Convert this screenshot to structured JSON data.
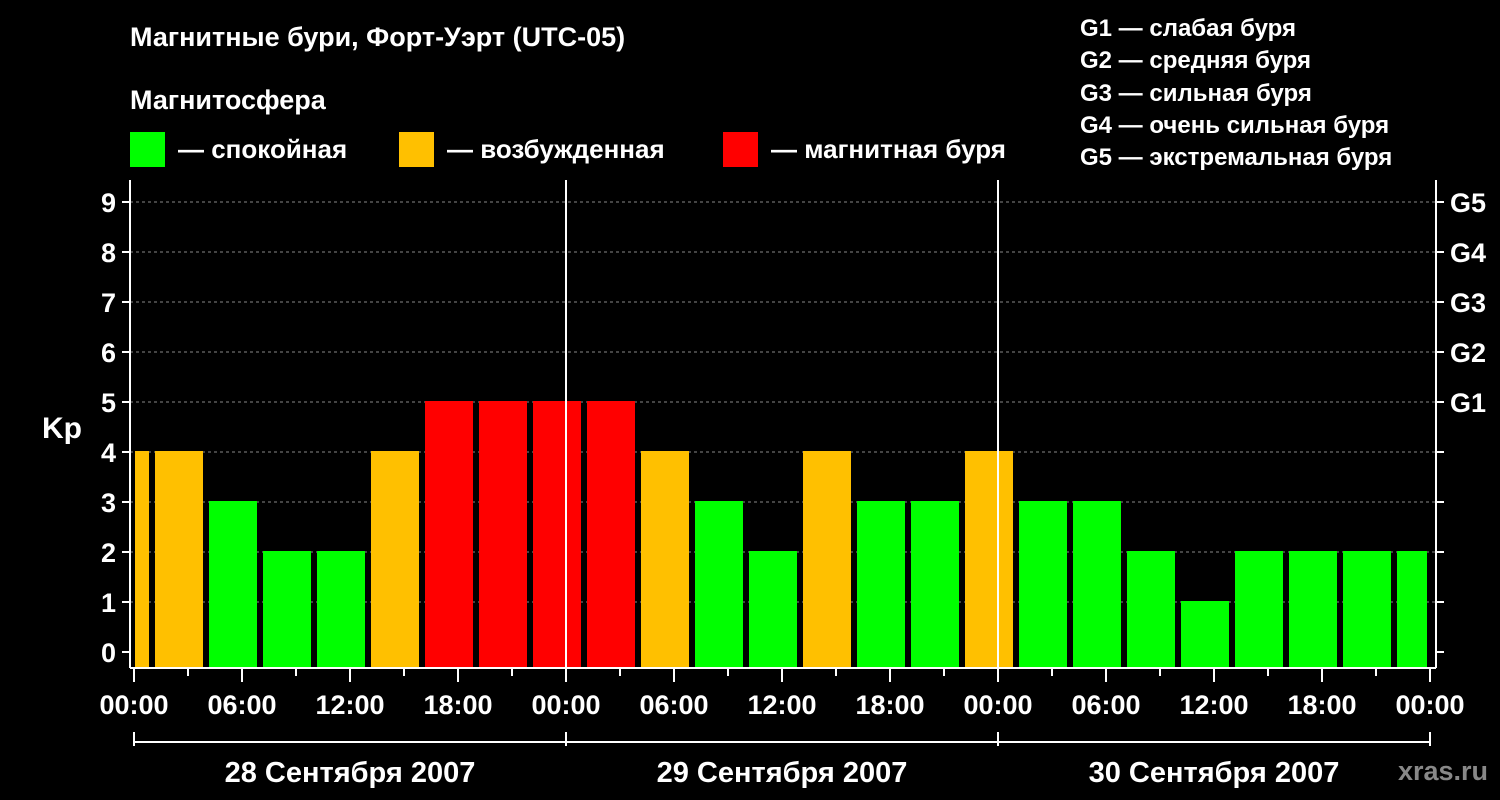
{
  "colors": {
    "quiet": "#00ff00",
    "active": "#ffc000",
    "storm": "#ff0000",
    "background": "#000000",
    "grid": "#888888"
  },
  "legend": {
    "heading": "Магнитосфера",
    "items": [
      {
        "label": "— спокойная",
        "color": "#00ff00"
      },
      {
        "label": "— возбужденная",
        "color": "#ffc000"
      },
      {
        "label": "— магнитная буря",
        "color": "#ff0000"
      }
    ],
    "g_scale": [
      "G1 — слабая буря",
      "G2 — средняя буря",
      "G3 — сильная буря",
      "G4 — очень сильная буря",
      "G5 — экстремальная буря"
    ]
  },
  "watermark": "xras.ru",
  "chart_data": {
    "type": "bar",
    "title": "Магнитные бури, Форт-Уэрт (UTC-05)",
    "ylabel": "Kp",
    "ylim": [
      0,
      9
    ],
    "yticks": [
      0,
      1,
      2,
      3,
      4,
      5,
      6,
      7,
      8,
      9
    ],
    "right_axis_labels": [
      {
        "y": 5,
        "label": "G1"
      },
      {
        "y": 6,
        "label": "G2"
      },
      {
        "y": 7,
        "label": "G3"
      },
      {
        "y": 8,
        "label": "G4"
      },
      {
        "y": 9,
        "label": "G5"
      }
    ],
    "xlim_hours": [
      0,
      72
    ],
    "xticks": [
      "00:00",
      "06:00",
      "12:00",
      "18:00",
      "00:00",
      "06:00",
      "12:00",
      "18:00",
      "00:00",
      "06:00",
      "12:00",
      "18:00",
      "00:00"
    ],
    "days": [
      "28 Сентября 2007",
      "29 Сентября 2007",
      "30 Сентября 2007"
    ],
    "bars": [
      {
        "start_hour": 0,
        "end_hour": 1,
        "value": 4,
        "level": "active"
      },
      {
        "start_hour": 1,
        "end_hour": 4,
        "value": 4,
        "level": "active"
      },
      {
        "start_hour": 4,
        "end_hour": 7,
        "value": 3,
        "level": "quiet"
      },
      {
        "start_hour": 7,
        "end_hour": 10,
        "value": 2,
        "level": "quiet"
      },
      {
        "start_hour": 10,
        "end_hour": 13,
        "value": 2,
        "level": "quiet"
      },
      {
        "start_hour": 13,
        "end_hour": 16,
        "value": 4,
        "level": "active"
      },
      {
        "start_hour": 16,
        "end_hour": 19,
        "value": 5,
        "level": "storm"
      },
      {
        "start_hour": 19,
        "end_hour": 22,
        "value": 5,
        "level": "storm"
      },
      {
        "start_hour": 22,
        "end_hour": 25,
        "value": 5,
        "level": "storm"
      },
      {
        "start_hour": 25,
        "end_hour": 28,
        "value": 5,
        "level": "storm"
      },
      {
        "start_hour": 28,
        "end_hour": 31,
        "value": 4,
        "level": "active"
      },
      {
        "start_hour": 31,
        "end_hour": 34,
        "value": 3,
        "level": "quiet"
      },
      {
        "start_hour": 34,
        "end_hour": 37,
        "value": 2,
        "level": "quiet"
      },
      {
        "start_hour": 37,
        "end_hour": 40,
        "value": 4,
        "level": "active"
      },
      {
        "start_hour": 40,
        "end_hour": 43,
        "value": 3,
        "level": "quiet"
      },
      {
        "start_hour": 43,
        "end_hour": 46,
        "value": 3,
        "level": "quiet"
      },
      {
        "start_hour": 46,
        "end_hour": 49,
        "value": 4,
        "level": "active"
      },
      {
        "start_hour": 49,
        "end_hour": 52,
        "value": 3,
        "level": "quiet"
      },
      {
        "start_hour": 52,
        "end_hour": 55,
        "value": 3,
        "level": "quiet"
      },
      {
        "start_hour": 55,
        "end_hour": 58,
        "value": 2,
        "level": "quiet"
      },
      {
        "start_hour": 58,
        "end_hour": 61,
        "value": 1,
        "level": "quiet"
      },
      {
        "start_hour": 61,
        "end_hour": 64,
        "value": 2,
        "level": "quiet"
      },
      {
        "start_hour": 64,
        "end_hour": 67,
        "value": 2,
        "level": "quiet"
      },
      {
        "start_hour": 67,
        "end_hour": 70,
        "value": 2,
        "level": "quiet"
      },
      {
        "start_hour": 70,
        "end_hour": 72,
        "value": 2,
        "level": "quiet"
      }
    ],
    "day_separators_hours": [
      24,
      48
    ],
    "grid": {
      "horizontal": true,
      "style": "dashed"
    }
  }
}
